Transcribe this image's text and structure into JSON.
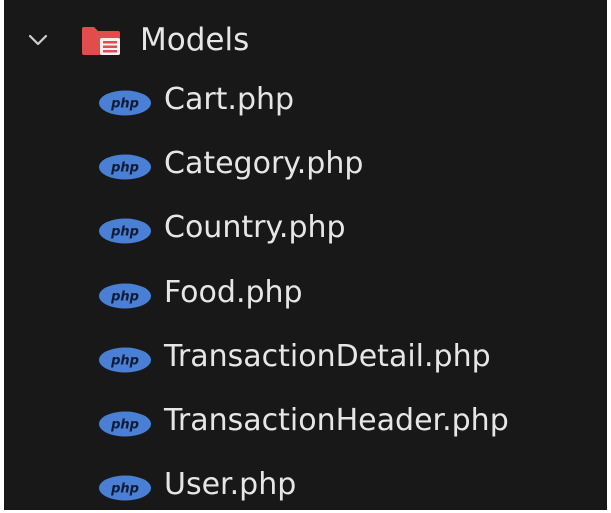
{
  "explorer": {
    "folder": {
      "label": "Models",
      "expanded": true,
      "icon": "folder-open-icon",
      "color": "#e34c4c"
    },
    "file_icon": {
      "name": "php-file-icon",
      "text": "php",
      "color": "#4a7fd6"
    },
    "files": [
      {
        "label": "Cart.php"
      },
      {
        "label": "Category.php"
      },
      {
        "label": "Country.php"
      },
      {
        "label": "Food.php"
      },
      {
        "label": "TransactionDetail.php"
      },
      {
        "label": "TransactionHeader.php"
      },
      {
        "label": "User.php"
      }
    ]
  }
}
